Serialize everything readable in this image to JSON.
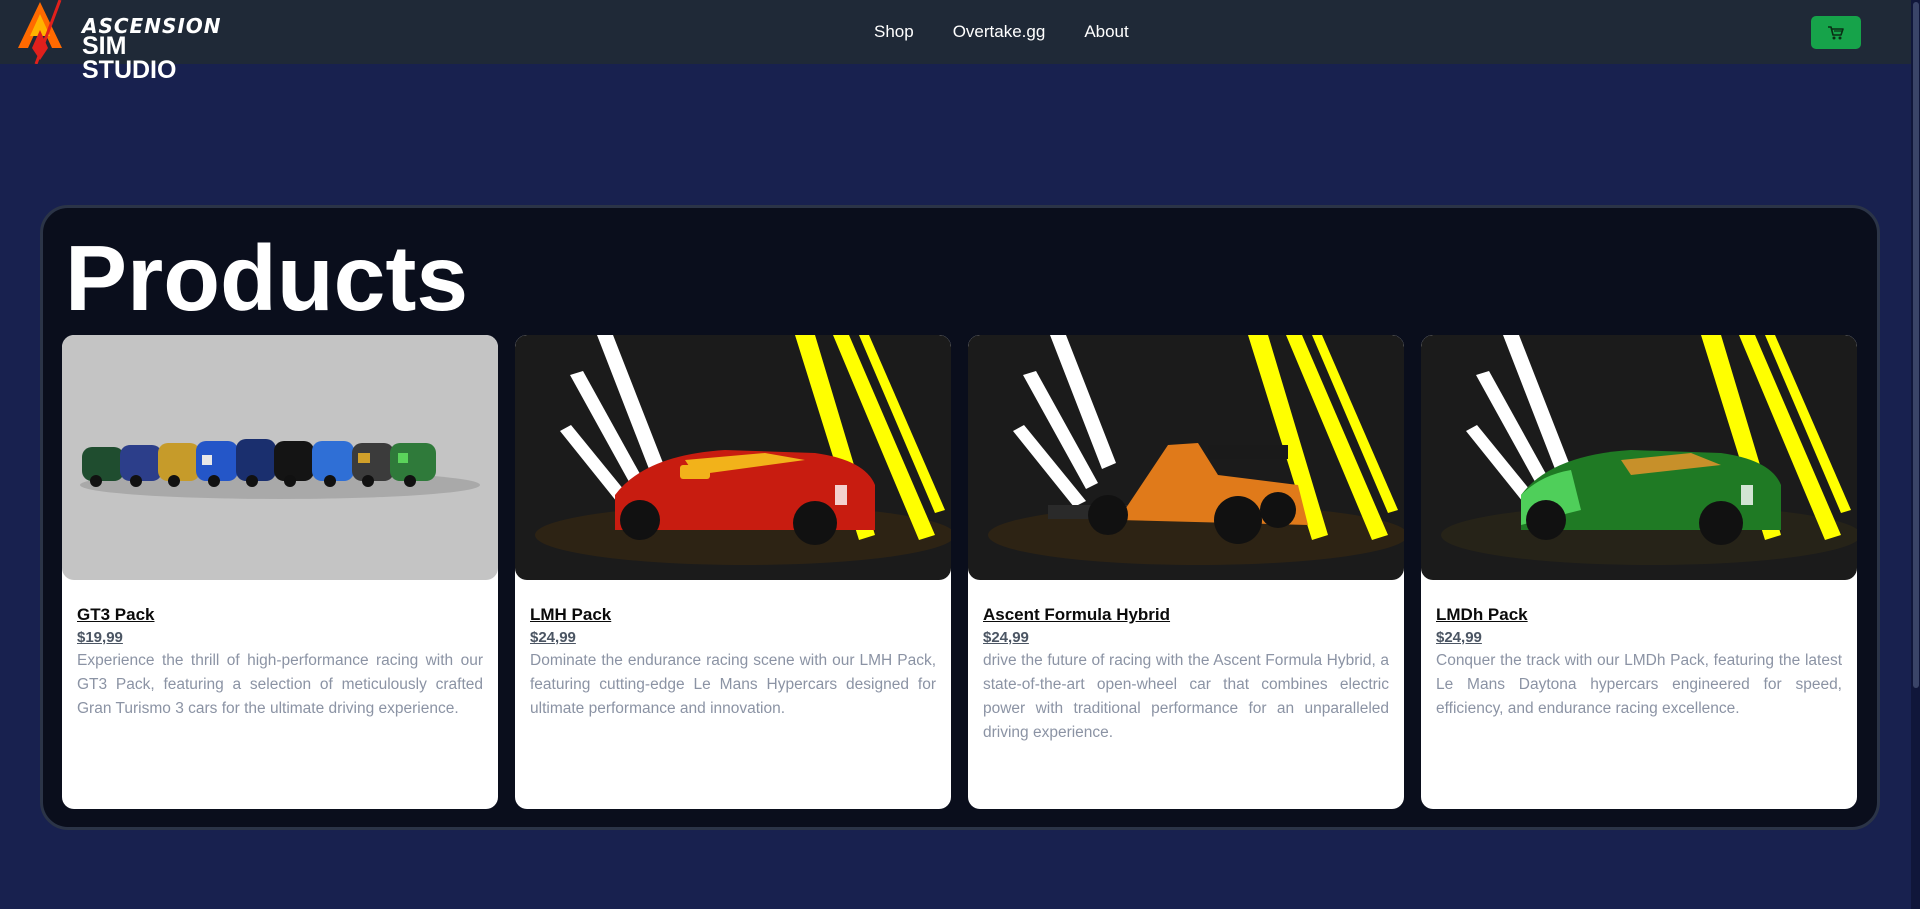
{
  "brand": {
    "line1": "ASCENSION",
    "line2": "SIM STUDIO"
  },
  "nav": {
    "links": [
      "Shop",
      "Overtake.gg",
      "About"
    ]
  },
  "cart": {
    "icon": "cart-icon"
  },
  "colors": {
    "background": "#18214f",
    "navbar": "#1f2937",
    "panel": "#0a0e1c",
    "cart_button": "#16a34a"
  },
  "main": {
    "title": "Products",
    "products": [
      {
        "name": "GT3 Pack",
        "price": "$19,99",
        "description": "Experience the thrill of high-performance racing with our GT3 Pack, featuring a selection of meticulously crafted Gran Turismo 3 cars for the ultimate driving experience."
      },
      {
        "name": "LMH Pack",
        "price": "$24,99",
        "description": "Dominate the endurance racing scene with our LMH Pack, featuring cutting-edge Le Mans Hypercars designed for ultimate performance and innovation."
      },
      {
        "name": "Ascent Formula Hybrid",
        "price": "$24,99",
        "description": "drive the future of racing with the Ascent Formula Hybrid, a state-of-the-art open-wheel car that combines electric power with traditional performance for an unparalleled driving experience."
      },
      {
        "name": "LMDh Pack",
        "price": "$24,99",
        "description": "Conquer the track with our LMDh Pack, featuring the latest Le Mans Daytona hypercars engineered for speed, efficiency, and endurance racing excellence."
      }
    ]
  }
}
